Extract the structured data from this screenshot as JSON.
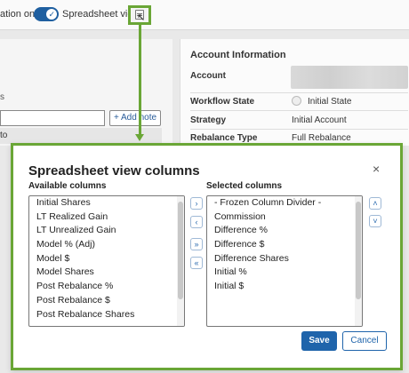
{
  "topbar": {
    "filter_label": "ation only",
    "view_label": "Spreadsheet view",
    "toggle_on": true
  },
  "left_panel": {
    "section_letter": "s",
    "add_note_label": "+ Add note",
    "row_text": "to"
  },
  "account_panel": {
    "title": "Account Information",
    "rows": [
      {
        "key": "Account",
        "value": ""
      },
      {
        "key": "Workflow State",
        "value": "Initial State"
      },
      {
        "key": "Strategy",
        "value": "Initial Account"
      },
      {
        "key": "Rebalance Type",
        "value": "Full Rebalance"
      }
    ]
  },
  "dialog": {
    "title": "Spreadsheet view columns",
    "close_icon": "×",
    "available_label": "Available columns",
    "selected_label": "Selected columns",
    "available": [
      "Initial Shares",
      "LT Realized Gain",
      "LT Unrealized Gain",
      "Model % (Adj)",
      "Model $",
      "Model Shares",
      "Post Rebalance %",
      "Post Rebalance $",
      "Post Rebalance Shares"
    ],
    "selected": [
      "- Frozen Column Divider -",
      "Commission",
      "Difference %",
      "Difference $",
      "Difference Shares",
      "Initial %",
      "Initial $"
    ],
    "move_buttons": {
      "move_right": "›",
      "move_left": "‹",
      "move_all_right": "»",
      "move_all_left": "«",
      "move_up": "˄",
      "move_down": "˅"
    },
    "save_label": "Save",
    "cancel_label": "Cancel"
  },
  "colors": {
    "accent": "#1f64ab",
    "highlight_border": "#6aa636"
  }
}
